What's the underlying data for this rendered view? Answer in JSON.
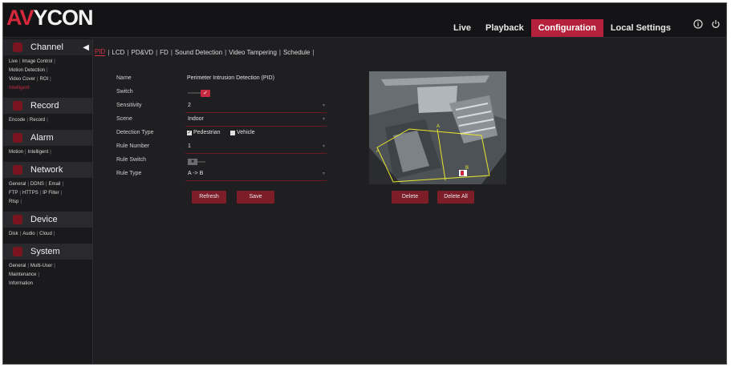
{
  "header": {
    "logo_text": "AVYCON",
    "nav": [
      "Live",
      "Playback",
      "Configuration",
      "Local Settings"
    ],
    "active_nav": "Configuration",
    "icons": [
      "info-icon",
      "power-icon"
    ]
  },
  "sidebar": {
    "sections": [
      {
        "title": "Channel",
        "links": [
          "Live",
          "Image Control",
          "Motion Detection",
          "Video Cover",
          "ROI",
          "Intelligent"
        ],
        "active": "Intelligent"
      },
      {
        "title": "Record",
        "links": [
          "Encode",
          "Record"
        ]
      },
      {
        "title": "Alarm",
        "links": [
          "Motion",
          "Intelligent"
        ]
      },
      {
        "title": "Network",
        "links": [
          "General",
          "DDNS",
          "Email",
          "FTP",
          "HTTPS",
          "IP Filter",
          "Rtsp"
        ]
      },
      {
        "title": "Device",
        "links": [
          "Disk",
          "Audio",
          "Cloud"
        ]
      },
      {
        "title": "System",
        "links": [
          "General",
          "Multi-User",
          "Maintenance",
          "Information"
        ]
      }
    ]
  },
  "tabs": [
    "PID",
    "LCD",
    "PD&VD",
    "FD",
    "Sound Detection",
    "Video Tampering",
    "Schedule"
  ],
  "active_tab": "PID",
  "form": {
    "name_label": "Name",
    "name_value": "Perimeter Intrusion Detection (PID)",
    "switch_label": "Switch",
    "sensitivity_label": "Sensitivity",
    "sensitivity_value": "2",
    "scene_label": "Scene",
    "scene_value": "Indoor",
    "detection_type_label": "Detection Type",
    "pedestrian_label": "Pedestrian",
    "vehicle_label": "Vehicle",
    "rule_number_label": "Rule Number",
    "rule_number_value": "1",
    "rule_switch_label": "Rule Switch",
    "rule_type_label": "Rule Type",
    "rule_type_value": "A -> B"
  },
  "buttons": {
    "refresh": "Refresh",
    "save": "Save",
    "delete": "Delete",
    "delete_all": "Delete All"
  },
  "colors": {
    "accent": "#b5203a",
    "background": "#1f1f22",
    "button": "#7c1d28"
  }
}
